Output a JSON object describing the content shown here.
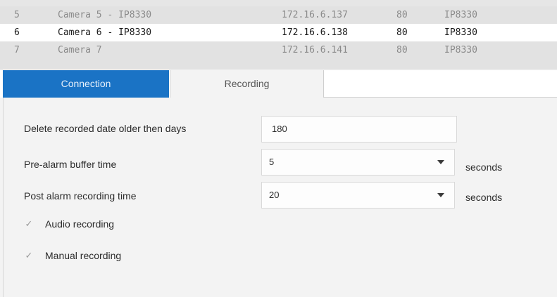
{
  "camera_table": {
    "rows": [
      {
        "num": "5",
        "name": "Camera 5 - IP8330",
        "ip": "172.16.6.137",
        "port": "80",
        "model": "IP8330"
      },
      {
        "num": "6",
        "name": "Camera 6 - IP8330",
        "ip": "172.16.6.138",
        "port": "80",
        "model": "IP8330"
      },
      {
        "num": "7",
        "name": "Camera 7",
        "ip": "172.16.6.141",
        "port": "80",
        "model": "IP8330"
      }
    ]
  },
  "tabs": {
    "connection": "Connection",
    "recording": "Recording",
    "active": "Recording",
    "accent_color": "#1a73c5"
  },
  "recording": {
    "delete_label": "Delete recorded date older then days",
    "delete_value": "180",
    "pre_alarm_label": "Pre-alarm buffer time",
    "pre_alarm_value": "5",
    "pre_alarm_unit": "seconds",
    "post_alarm_label": "Post alarm recording time",
    "post_alarm_value": "20",
    "post_alarm_unit": "seconds",
    "audio_label": "Audio recording",
    "audio_checked": true,
    "manual_label": "Manual recording",
    "manual_checked": true
  },
  "icons": {
    "dropdown": "chevron-down-icon",
    "check": "checkmark-icon"
  }
}
